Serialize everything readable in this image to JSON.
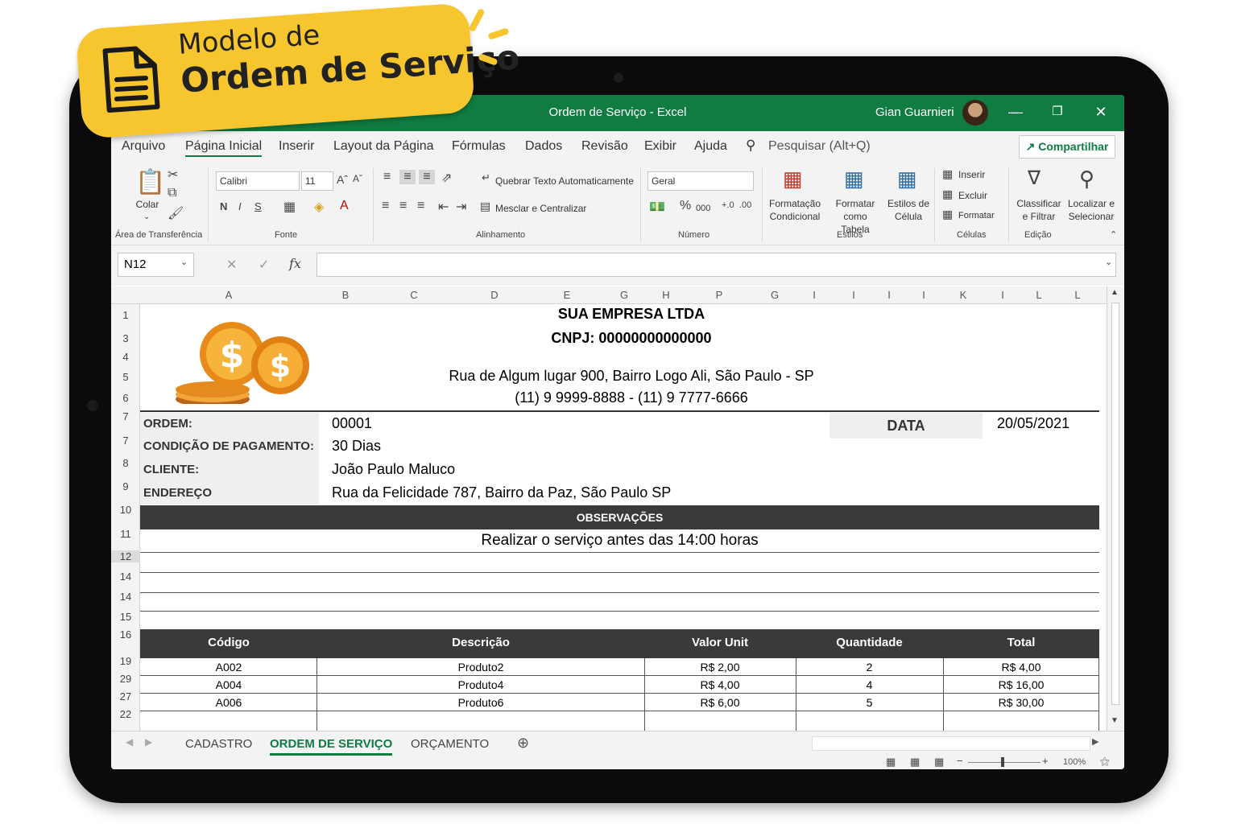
{
  "badge": {
    "line1": "Modelo de",
    "line2": "Ordem de Serviço"
  },
  "window": {
    "title": "Ordem de Serviço - Excel",
    "user": "Gian Guarnieri"
  },
  "menu": {
    "items": [
      "Arquivo",
      "Página Inicial",
      "Inserir",
      "Layout da Página",
      "Fórmulas",
      "Dados",
      "Revisão",
      "Exibir",
      "Ajuda"
    ],
    "search_placeholder": "Pesquisar (Alt+Q)",
    "share": "Compartilhar"
  },
  "ribbon": {
    "paste": "Colar",
    "clipboard_group": "Área de Transferência",
    "font_name": "Calibri",
    "font_size": "11",
    "bold": "N",
    "italic": "I",
    "underline": "S",
    "font_group": "Fonte",
    "wrap_text": "Quebrar Texto Automaticamente",
    "merge_center": "Mesclar e Centralizar",
    "alignment_group": "Alinhamento",
    "number_format": "Geral",
    "thousands": "000",
    "number_group": "Número",
    "cond_format": [
      "Formatação",
      "Condicional"
    ],
    "format_table": [
      "Formatar como",
      "Tabela"
    ],
    "cell_styles": [
      "Estilos de",
      "Célula"
    ],
    "styles_group": "Estilos",
    "insert": "Inserir",
    "delete": "Excluir",
    "format": "Formatar",
    "cells_group": "Células",
    "sort_filter": [
      "Classificar",
      "e Filtrar"
    ],
    "find_select": [
      "Localizar e",
      "Selecionar"
    ],
    "editing_group": "Edição"
  },
  "formula_bar": {
    "name_box": "N12",
    "fx": "fx",
    "value": ""
  },
  "columns": [
    "A",
    "B",
    "C",
    "D",
    "E",
    "G",
    "H",
    "P",
    "G",
    "I",
    "I",
    "I",
    "I",
    "K",
    "I",
    "L",
    "L"
  ],
  "rows": [
    "1",
    "3",
    "4",
    "5",
    "6",
    "7",
    "7",
    "8",
    "9",
    "10",
    "11",
    "12",
    "14",
    "14",
    "15",
    "16",
    "19",
    "29",
    "27",
    "22"
  ],
  "company": {
    "name": "SUA EMPRESA LTDA",
    "cnpj": "CNPJ: 00000000000000",
    "address": "Rua de Algum lugar 900, Bairro Logo Ali, São Paulo  - SP",
    "phones": "(11) 9 9999-8888 - (11) 9 7777-6666"
  },
  "order": {
    "ordem_label": "ORDEM:",
    "ordem_value": "00001",
    "data_label": "DATA",
    "data_value": "20/05/2021",
    "pagamento_label": "CONDIÇÃO DE PAGAMENTO:",
    "pagamento_value": "30 Dias",
    "cliente_label": "CLIENTE:",
    "cliente_value": "João Paulo Maluco",
    "endereco_label": "ENDEREÇO",
    "endereco_value": "Rua da Felicidade 787, Bairro da Paz, São Paulo SP"
  },
  "observacoes": {
    "title": "OBSERVAÇÕES",
    "text": "Realizar o serviço antes das 14:00 horas"
  },
  "items_table": {
    "headers": [
      "Código",
      "Descrição",
      "Valor Unit",
      "Quantidade",
      "Total"
    ],
    "rows": [
      [
        "A002",
        "Produto2",
        "R$ 2,00",
        "2",
        "R$ 4,00"
      ],
      [
        "A004",
        "Produto4",
        "R$ 4,00",
        "4",
        "R$ 16,00"
      ],
      [
        "A006",
        "Produto6",
        "R$ 6,00",
        "5",
        "R$ 30,00"
      ]
    ]
  },
  "sheet_tabs": [
    "CADASTRO",
    "ORDEM DE SERVIÇO",
    "ORÇAMENTO"
  ],
  "status": {
    "zoom": "100%"
  },
  "colors": {
    "excel_green": "#107c41",
    "badge_yellow": "#f7c52e",
    "header_dark": "#3a3a3a"
  }
}
